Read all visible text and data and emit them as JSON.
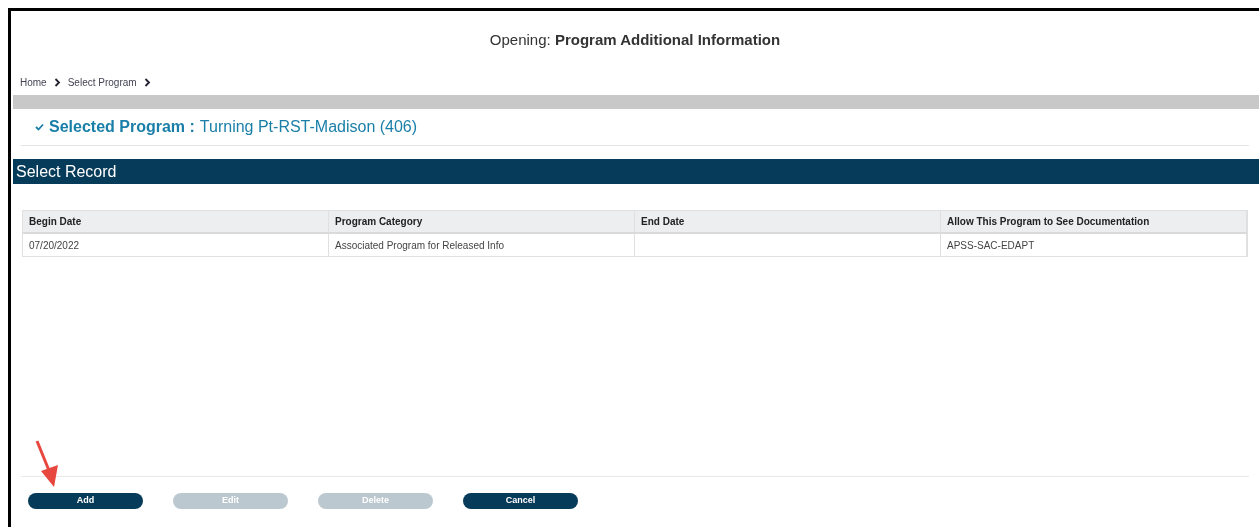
{
  "page": {
    "title": "Opening: **Program Additional Information**"
  },
  "breadcrumb": [
    {
      "label": "Home"
    },
    {
      "label": "Select Program"
    }
  ],
  "selected_program": {
    "label": "Selected Program :",
    "value": "Turning Pt-RST-Madison (406)",
    "expanded": true
  },
  "section": {
    "title": "Select Record"
  },
  "table": {
    "columns": [
      "Begin Date",
      "Program Category",
      "End Date",
      "Allow This Program to See Documentation"
    ],
    "rows": [
      [
        "07/20/2022",
        "Associated Program for Released Info",
        "",
        "APSS-SAC-EDAPT"
      ]
    ]
  },
  "buttons": [
    {
      "label": "Add",
      "disabled": false
    },
    {
      "label": "Edit",
      "disabled": true
    },
    {
      "label": "Delete",
      "disabled": true
    },
    {
      "label": "Cancel",
      "disabled": false
    }
  ]
}
